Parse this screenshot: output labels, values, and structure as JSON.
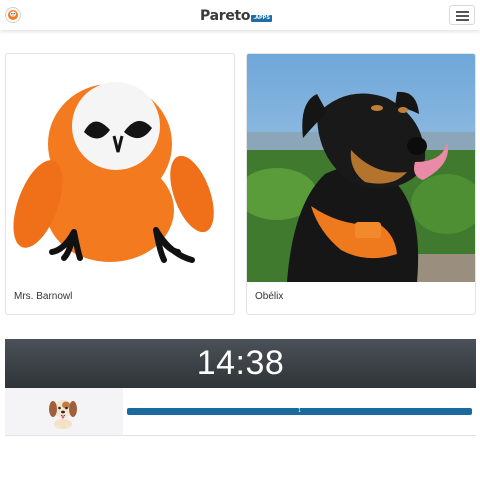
{
  "app": {
    "brand": "Pareto",
    "brand_badge": ".APPS"
  },
  "cards": [
    {
      "name": "Mrs. Barnowl",
      "image": "crocheted-owl-toy"
    },
    {
      "name": "Obélix",
      "image": "dog-photo"
    }
  ],
  "timer": {
    "display": "14:38"
  },
  "rows": [
    {
      "avatar": "puppy-emoji",
      "progress_label": "1",
      "progress_fraction": 1.0
    }
  ],
  "colors": {
    "accent": "#1a6a9f",
    "timer_bg": "#343a40"
  }
}
